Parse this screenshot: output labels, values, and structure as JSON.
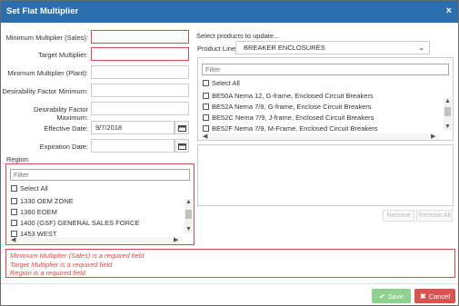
{
  "dialog": {
    "title": "Set Flat Multiplier",
    "close_glyph": "×"
  },
  "form": {
    "min_multiplier_sales_label": "Minimum Multiplier (Sales):",
    "min_multiplier_sales_value": "",
    "target_multiplier_label": "Target Multiplier:",
    "target_multiplier_value": "",
    "min_multiplier_plant_label": "Minimum Multiplier (Plant):",
    "min_multiplier_plant_value": "",
    "desirability_min_label": "Desirability Factor Minimum:",
    "desirability_min_value": "",
    "desirability_max_label": "Desirability Factor Maximum:",
    "desirability_max_value": "",
    "effective_date_label": "Effective Date:",
    "effective_date_value": "9/7/2018",
    "expiration_date_label": "Expiration Date:",
    "expiration_date_value": ""
  },
  "region": {
    "label": "Region:",
    "filter_placeholder": "Filter",
    "select_all_label": "Select All",
    "items": [
      "1330 OEM ZONE",
      "1360 EOEM",
      "1400 (GSF) GENERAL SALES FORCE",
      "1453 WEST"
    ]
  },
  "products": {
    "heading": "Select products to update...",
    "product_line_label": "Product Line:",
    "product_line_value": "BREAKER ENCLOSURES",
    "filter_placeholder": "Filter",
    "select_all_label": "Select All",
    "items": [
      "BE50A Nema 12, G-frame, Enclosed Circuit Breakers",
      "BE52A Nema 7/9, G-frame, Enclose Circuit Breakers",
      "BE52C Nema 7/9, J-frame, Enclosed Circuit Breakers",
      "BE52F Nema 7/9, M-Frame, Enclosed Circuit Breakers"
    ],
    "remove_label": "Remove",
    "remove_all_label": "Remove All"
  },
  "errors": [
    "Minimum Multiplier (Sales) is a required field",
    "Target Multiplier is a required field",
    "Region is a required field"
  ],
  "footer": {
    "save_label": "Save",
    "cancel_label": "Cancel"
  },
  "colors": {
    "titlebar": "#2b6fae",
    "error": "#d94a4a",
    "save": "#8fd18f",
    "cancel": "#d9534f"
  }
}
